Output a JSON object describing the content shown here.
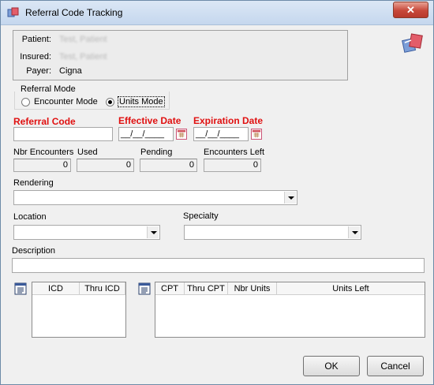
{
  "window": {
    "title": "Referral Code Tracking",
    "close_glyph": "✕"
  },
  "patient_info": {
    "patient_label": "Patient:",
    "patient_value": "Test, Patient",
    "insured_label": "Insured:",
    "insured_value": "Test, Patient",
    "payer_label": "Payer:",
    "payer_value": "Cigna"
  },
  "referral_mode": {
    "legend": "Referral Mode",
    "options": [
      "Encounter Mode",
      "Units Mode"
    ],
    "selected": "Units Mode"
  },
  "fields": {
    "referral_code_label": "Referral Code",
    "referral_code_value": "",
    "effective_date_label": "Effective Date",
    "effective_date_value": "__/__/____",
    "expiration_date_label": "Expiration Date",
    "expiration_date_value": "__/__/____"
  },
  "counts": {
    "nbr_encounters_label": "Nbr Encounters",
    "nbr_encounters_value": "0",
    "used_label": "Used",
    "used_value": "0",
    "pending_label": "Pending",
    "pending_value": "0",
    "encounters_left_label": "Encounters Left",
    "encounters_left_value": "0"
  },
  "dropdowns": {
    "rendering_label": "Rendering",
    "location_label": "Location",
    "specialty_label": "Specialty"
  },
  "description_label": "Description",
  "icd_table": {
    "columns": [
      "ICD",
      "Thru ICD"
    ]
  },
  "cpt_table": {
    "columns": [
      "CPT",
      "Thru CPT",
      "Nbr Units",
      "Units Left"
    ]
  },
  "buttons": {
    "ok": "OK",
    "cancel": "Cancel"
  },
  "colors": {
    "required": "#e01010",
    "titlebar": "#c5d7ee",
    "close": "#c7483a"
  },
  "icons": [
    "referral-app-icon",
    "referral-header-icon",
    "calendar-icon",
    "notepad-icon"
  ]
}
